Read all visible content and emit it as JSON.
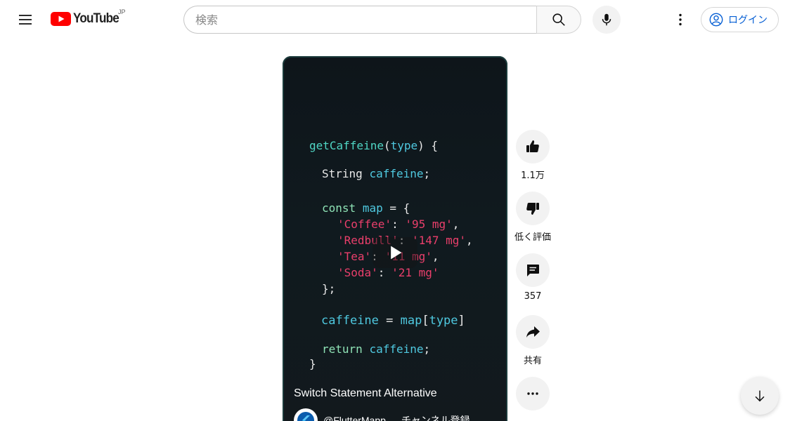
{
  "header": {
    "logo_text": "YouTube",
    "region": "JP",
    "search_placeholder": "検索",
    "login_label": "ログイン"
  },
  "icons": {
    "menu": "hamburger-menu-icon",
    "search": "search-icon",
    "mic": "microphone-icon",
    "more": "more-vert-icon",
    "account": "account-circle-icon",
    "like": "thumb-up-icon",
    "dislike": "thumb-down-icon",
    "comments": "comment-icon",
    "share": "share-arrow-icon",
    "more_actions": "more-horiz-icon",
    "play": "play-icon",
    "scroll_down": "arrow-down-icon"
  },
  "colors": {
    "brand_red": "#ff0000",
    "link_blue": "#065fd4",
    "code_function": "#4fd6c4",
    "code_keyword": "#8ee2b5",
    "code_variable": "#4fc9e0",
    "code_string": "#ea3f6b"
  },
  "video": {
    "title": "Switch Statement Alternative",
    "channel_name": "@FlutterMapp",
    "subscribe_label": "チャンネル登録",
    "code": {
      "l1_fn": "getCaffeine",
      "l1_open": "(",
      "l1_param": "type",
      "l1_close": ") {",
      "l2_type": "String",
      "l2_var": "caffeine",
      "l2_semi": ";",
      "l3_kw": "const",
      "l3_var": "map",
      "l3_rest": " = {",
      "l4_key": "'Coffee'",
      "l4_colon": ": ",
      "l4_val": "'95 mg'",
      "l4_comma": ",",
      "l5_key": "'Redbull'",
      "l5_colon": ": ",
      "l5_val": "'147 mg'",
      "l5_comma": ",",
      "l6_key": "'Tea'",
      "l6_colon": ": ",
      "l6_val": "'11 mg'",
      "l6_comma": ",",
      "l7_key": "'Soda'",
      "l7_colon": ": ",
      "l7_val": "'21 mg'",
      "l8": "};",
      "l9_var": "caffeine",
      "l9_eq": " = ",
      "l9_map": "map",
      "l9_open": "[",
      "l9_type": "type",
      "l9_close": "]",
      "l10_kw": "return",
      "l10_var": "caffeine",
      "l10_semi": ";",
      "l11": "}"
    }
  },
  "actions": {
    "like_count": "1.1万",
    "dislike_label": "低く評価",
    "comment_count": "357",
    "share_label": "共有"
  }
}
